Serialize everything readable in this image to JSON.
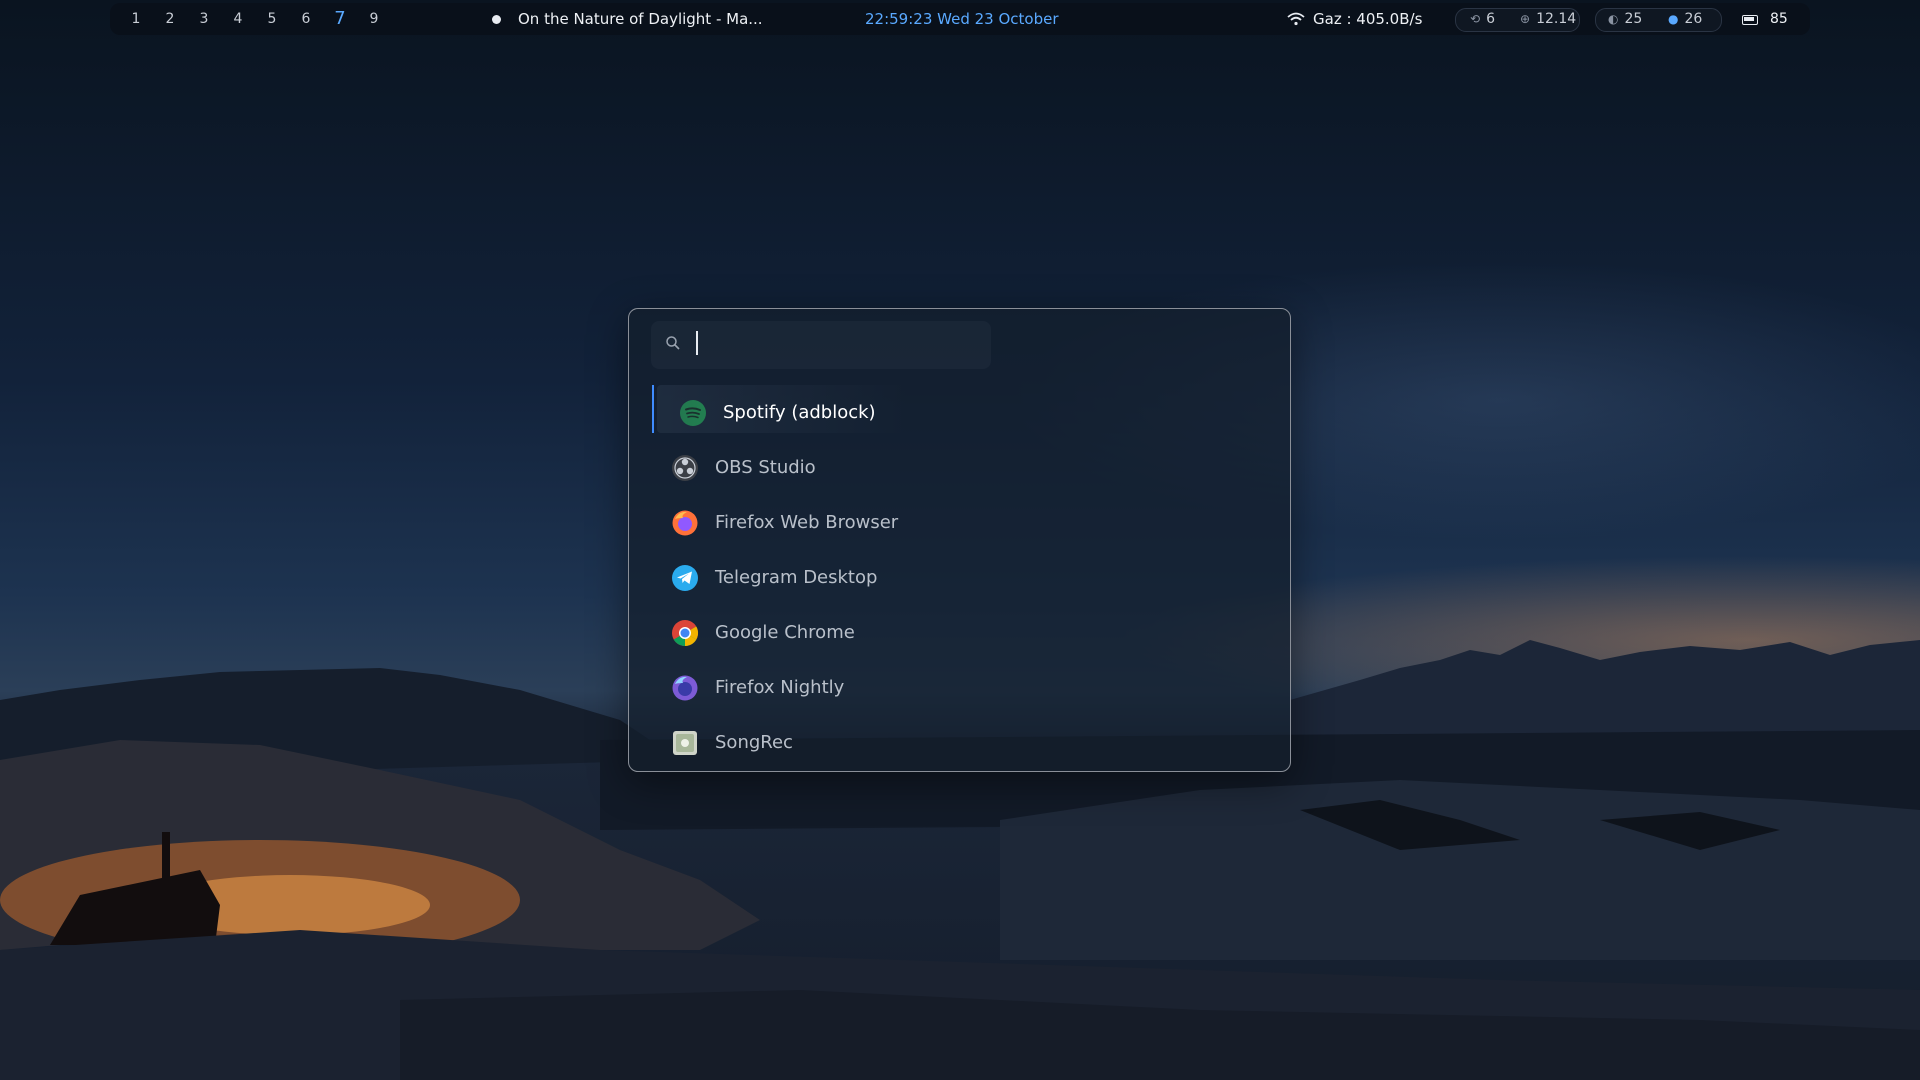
{
  "topbar": {
    "workspaces": [
      "1",
      "2",
      "3",
      "4",
      "5",
      "6",
      "7",
      "9"
    ],
    "active_workspace": "7",
    "now_playing": "On the Nature of Daylight - Ma...",
    "clock": "22:59:23  Wed 23 October",
    "network": "Gaz  :  405.0B/s",
    "stat_updates": "6",
    "stat_cpu": "12.14",
    "stat_brightness": "25",
    "stat_temp": "26",
    "battery": "85",
    "accent_color": "#5aa9ff"
  },
  "launcher": {
    "search_placeholder": "",
    "search_value": "",
    "apps": [
      {
        "label": "Spotify (adblock)",
        "icon": "spotify-icon",
        "selected": true
      },
      {
        "label": "OBS Studio",
        "icon": "obs-icon"
      },
      {
        "label": "Firefox Web Browser",
        "icon": "firefox-icon"
      },
      {
        "label": "Telegram Desktop",
        "icon": "telegram-icon"
      },
      {
        "label": "Google Chrome",
        "icon": "chrome-icon"
      },
      {
        "label": "Firefox Nightly",
        "icon": "firefox-nightly-icon"
      },
      {
        "label": "SongRec",
        "icon": "songrec-icon"
      }
    ]
  }
}
